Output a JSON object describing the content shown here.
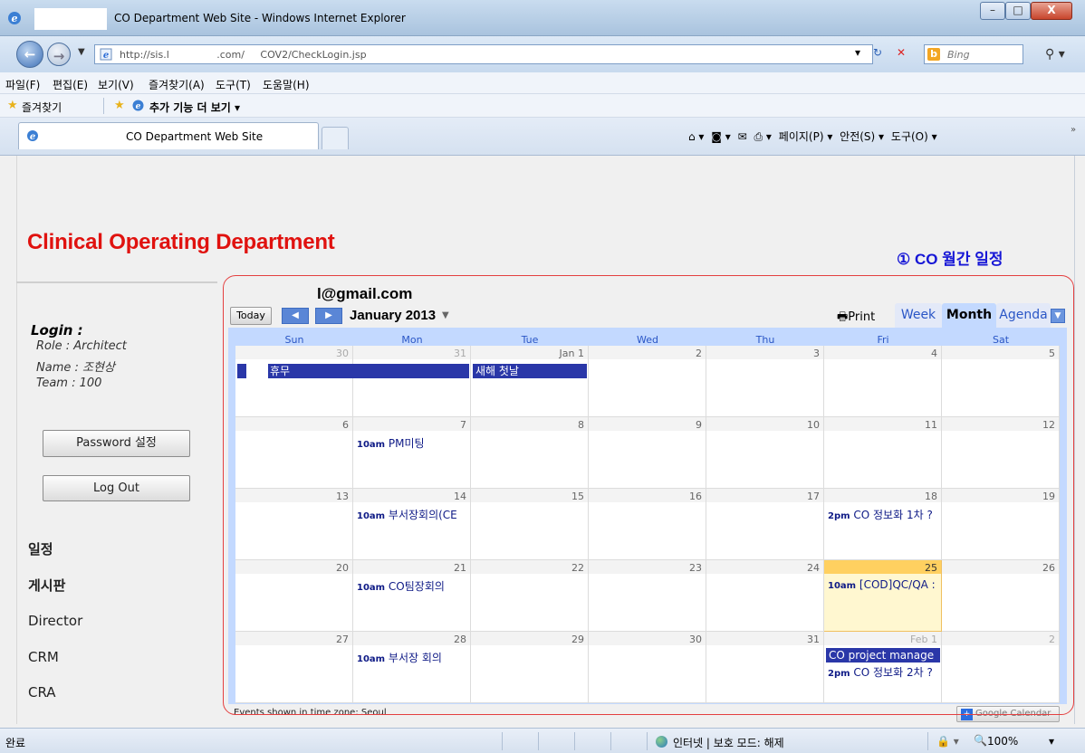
{
  "window": {
    "title": "CO Department Web Site - Windows Internet Explorer",
    "min": "–",
    "max": "□",
    "close": "X"
  },
  "address": {
    "url": "http://sis.l               .com/     COV2/CheckLogin.jsp",
    "search_placeholder": "Bing",
    "bing_icon": "b"
  },
  "menu": [
    "파일(F)",
    "편집(E)",
    "보기(V)",
    "즐겨찾기(A)",
    "도구(T)",
    "도움말(H)"
  ],
  "favorites": {
    "label": "즐겨찾기",
    "more": "추가 기능 더 보기 ▾"
  },
  "tab": {
    "title": "CO Department Web Site"
  },
  "commandbar": {
    "home": "⌂ ▾",
    "feeds": "◙ ▾",
    "mail": "✉",
    "print": "⎙ ▾",
    "page": "페이지(P) ▾",
    "safety": "안전(S) ▾",
    "tools": "도구(O) ▾"
  },
  "page": {
    "dept_title": "Clinical Operating Department",
    "annotation": "① CO 월간 일정",
    "login": {
      "title": "Login :",
      "role": "Role : Architect",
      "name": "Name : 조현상",
      "team": "Team : 100"
    },
    "buttons": {
      "password": "Password 설정",
      "logout": "Log Out"
    },
    "nav": {
      "schedule": "일정",
      "board": "게시판",
      "director": "Director",
      "crm": "CRM",
      "cra": "CRA"
    }
  },
  "calendar": {
    "email": "l@gmail.com",
    "today": "Today",
    "prev": "◀",
    "next": "▶",
    "month": "January 2013",
    "month_arrow": "▼",
    "print": "🖶Print",
    "views": {
      "week": "Week",
      "month": "Month",
      "agenda": "Agenda",
      "menu": "▼"
    },
    "days_of_week": [
      "Sun",
      "Mon",
      "Tue",
      "Wed",
      "Thu",
      "Fri",
      "Sat"
    ],
    "weeks": [
      [
        "30",
        "31",
        "Jan 1",
        "2",
        "3",
        "4",
        "5"
      ],
      [
        "6",
        "7",
        "8",
        "9",
        "10",
        "11",
        "12"
      ],
      [
        "13",
        "14",
        "15",
        "16",
        "17",
        "18",
        "19"
      ],
      [
        "20",
        "21",
        "22",
        "23",
        "24",
        "25",
        "26"
      ],
      [
        "27",
        "28",
        "29",
        "30",
        "31",
        "Feb 1",
        "2"
      ]
    ],
    "allday_events": {
      "vacation": "휴무",
      "newyear": "새해 첫날",
      "co_project": "CO project manage"
    },
    "timed_events": {
      "e_jan7": {
        "time": "10am",
        "title": "PM미팅"
      },
      "e_jan14": {
        "time": "10am",
        "title": "부서장회의(CE"
      },
      "e_jan18": {
        "time": "2pm",
        "title": "CO 정보화 1차 ?"
      },
      "e_jan21": {
        "time": "10am",
        "title": "CO팀장회의"
      },
      "e_jan25": {
        "time": "10am",
        "title": "[COD]QC/QA :"
      },
      "e_jan28": {
        "time": "10am",
        "title": "부서장 회의"
      },
      "e_feb1": {
        "time": "2pm",
        "title": "CO 정보화 2차 ?"
      }
    },
    "timezone_note": "Events shown in time zone: Seoul",
    "gcal_badge": "Google Calendar",
    "gcal_icon": "+"
  },
  "status": {
    "done": "완료",
    "zone": "인터넷 | 보호 모드: 해제",
    "zoom": "100%",
    "zoom_icon": "🔍",
    "zoom_arrow": "▾",
    "security_icon": "🔒 ▾"
  },
  "colors": {
    "dept_title": "#e0120f",
    "annotation": "#1616d6",
    "event_bar": "#2a37a8",
    "today_cell": "#fff7d0"
  }
}
